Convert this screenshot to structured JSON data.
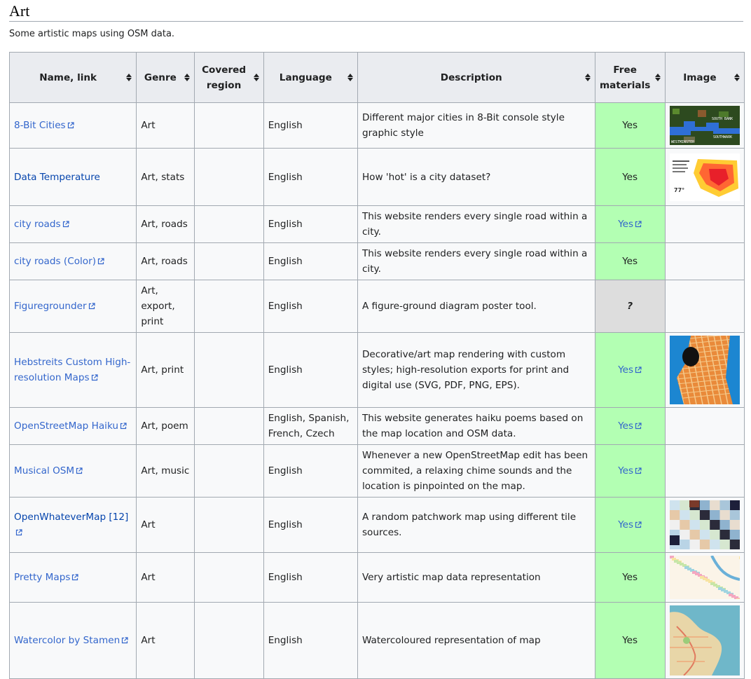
{
  "section": {
    "title": "Art",
    "intro": "Some artistic maps using OSM data."
  },
  "table": {
    "headers": [
      "Name, link",
      "Genre",
      "Covered region",
      "Language",
      "Description",
      "Free materials",
      "Image"
    ],
    "rows": [
      {
        "name": "8-Bit Cities",
        "link_type": "external",
        "genre": "Art",
        "region": "",
        "language": "English",
        "description": "Different major cities in 8-Bit console style graphic style",
        "free": "Yes",
        "free_link": false,
        "free_status": "yes",
        "image": "8bit-thumbnail"
      },
      {
        "name": "Data Temperature",
        "link_type": "internal",
        "genre": "Art, stats",
        "region": "",
        "language": "English",
        "description": "How 'hot' is a city dataset?",
        "free": "Yes",
        "free_link": false,
        "free_status": "yes",
        "image": "heatmap-thumbnail"
      },
      {
        "name": "city roads",
        "link_type": "external",
        "genre": "Art, roads",
        "region": "",
        "language": "English",
        "description": "This website renders every single road within a city.",
        "free": "Yes",
        "free_link": true,
        "free_status": "yes",
        "image": ""
      },
      {
        "name": "city roads (Color)",
        "link_type": "external",
        "genre": "Art, roads",
        "region": "",
        "language": "English",
        "description": "This website renders every single road within a city.",
        "free": "Yes",
        "free_link": false,
        "free_status": "yes",
        "image": ""
      },
      {
        "name": "Figuregrounder",
        "link_type": "external",
        "genre": "Art, export, print",
        "region": "",
        "language": "English",
        "description": "A figure-ground diagram poster tool.",
        "free": "?",
        "free_link": false,
        "free_status": "unknown",
        "image": ""
      },
      {
        "name": "Hebstreits Custom High-resolution Maps",
        "link_type": "external",
        "genre": "Art, print",
        "region": "",
        "language": "English",
        "description": "Decorative/art map rendering with custom styles; high-resolution exports for print and digital use (SVG, PDF, PNG, EPS).",
        "free": "Yes",
        "free_link": true,
        "free_status": "yes",
        "image": "city-grid-thumbnail"
      },
      {
        "name": "OpenStreetMap Haiku",
        "link_type": "external",
        "genre": "Art, poem",
        "region": "",
        "language": "English, Spanish, French, Czech",
        "description": "This website generates haiku poems based on the map location and OSM data.",
        "free": "Yes",
        "free_link": true,
        "free_status": "yes",
        "image": ""
      },
      {
        "name": "Musical OSM",
        "link_type": "external",
        "genre": "Art, music",
        "region": "",
        "language": "English",
        "description": "Whenever a new OpenStreetMap edit has been commited, a relaxing chime sounds and the location is pinpointed on the map.",
        "free": "Yes",
        "free_link": true,
        "free_status": "yes",
        "image": ""
      },
      {
        "name": "OpenWhateverMap [12]",
        "link_type": "internal-external",
        "genre": "Art",
        "region": "",
        "language": "English",
        "description": "A random patchwork map using different tile sources.",
        "free": "Yes",
        "free_link": true,
        "free_status": "yes",
        "image": "patchwork-thumbnail"
      },
      {
        "name": "Pretty Maps",
        "link_type": "external",
        "genre": "Art",
        "region": "",
        "language": "English",
        "description": "Very artistic map data representation",
        "free": "Yes",
        "free_link": false,
        "free_status": "yes",
        "image": "pretty-thumbnail"
      },
      {
        "name": "Watercolor by Stamen",
        "link_type": "external",
        "genre": "Art",
        "region": "",
        "language": "English",
        "description": "Watercoloured representation of map",
        "free": "Yes",
        "free_link": false,
        "free_status": "yes",
        "image": "watercolor-thumbnail"
      }
    ]
  },
  "thumbnail_labels": {
    "8bit": [
      "SOUTH BANK",
      "SOUTHWARK",
      "WESTMINSTER"
    ],
    "heatmap": "77°"
  },
  "colors": {
    "link_external": "#3366cc",
    "link_internal": "#0645ad",
    "yes_bg": "#b3ffb3",
    "unknown_bg": "#dddddd",
    "header_bg": "#eaecf0",
    "border": "#a2a9b1"
  }
}
